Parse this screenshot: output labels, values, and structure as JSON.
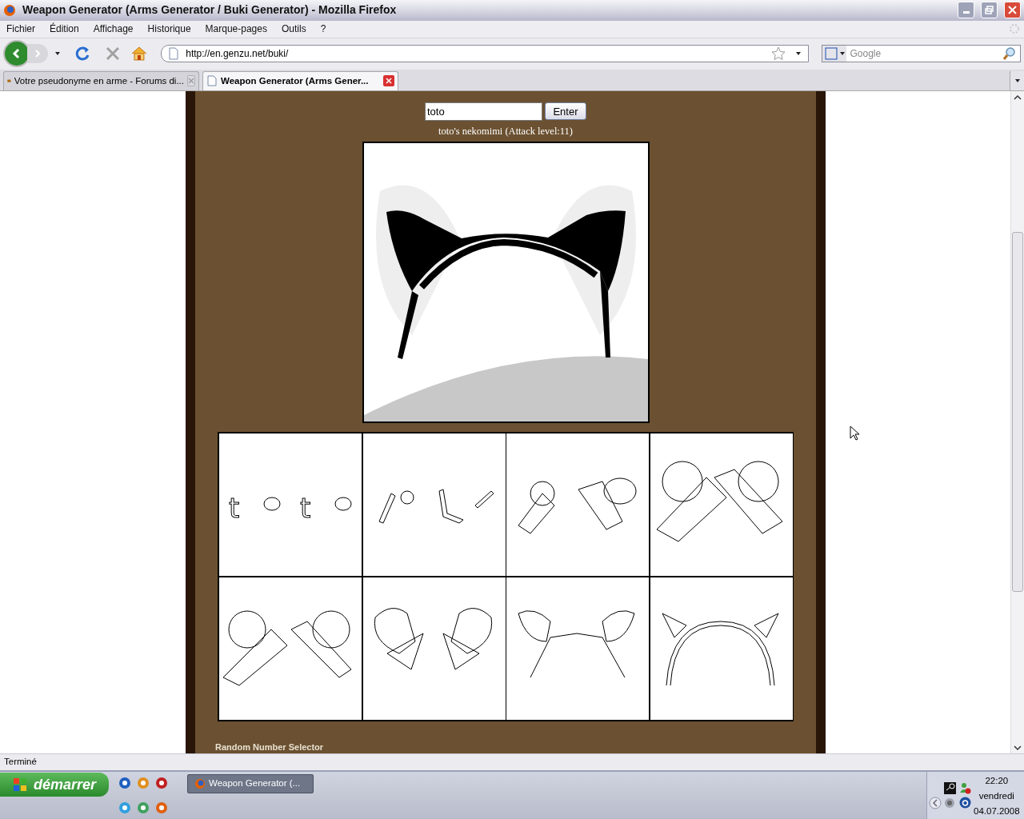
{
  "window": {
    "title": "Weapon Generator (Arms Generator / Buki Generator) - Mozilla Firefox"
  },
  "menu": [
    "Fichier",
    "Édition",
    "Affichage",
    "Historique",
    "Marque-pages",
    "Outils",
    "?"
  ],
  "address_bar": {
    "value": "http://en.genzu.net/buki/"
  },
  "search": {
    "placeholder": "Google"
  },
  "tabs": [
    {
      "label": "Votre pseudonyme en arme - Forums di...",
      "selected": false
    },
    {
      "label": "Weapon Generator (Arms Gener...",
      "selected": true
    }
  ],
  "page": {
    "name_field": {
      "value": "toto"
    },
    "submit_button": "Enter",
    "result_caption": "toto's nekomimi (Attack level:11)",
    "frames": [
      {
        "kind": "letters",
        "glyphs": [
          "t",
          "t"
        ]
      },
      {
        "kind": "split"
      },
      {
        "kind": "twist"
      },
      {
        "kind": "merge"
      },
      {
        "kind": "loops"
      },
      {
        "kind": "fold"
      },
      {
        "kind": "ears"
      },
      {
        "kind": "headband"
      }
    ],
    "footer_heading": "Random Number Selector"
  },
  "status_bar": "Terminé",
  "taskbar": {
    "start": "démarrer",
    "tasks": [
      "Weapon Generator (..."
    ],
    "clock": {
      "time": "22:20",
      "day": "vendredi",
      "date": "04.07.2008"
    }
  }
}
